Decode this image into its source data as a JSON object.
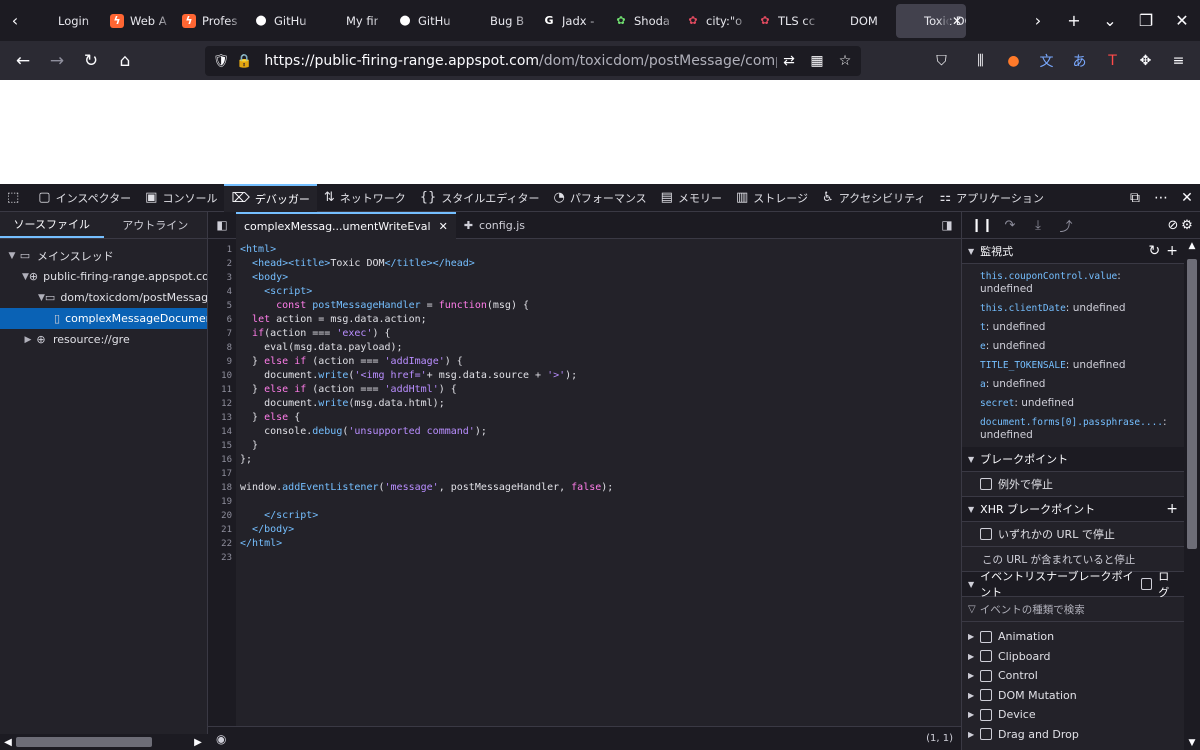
{
  "tabs": [
    {
      "label": "Login",
      "favicon": "",
      "color": ""
    },
    {
      "label": "Web A",
      "favicon": "burp-icon",
      "color": "#ff6633"
    },
    {
      "label": "Profes",
      "favicon": "burp-icon",
      "color": "#ff6633"
    },
    {
      "label": "GitHu",
      "favicon": "github-icon",
      "color": "#ffffff"
    },
    {
      "label": "My fir",
      "favicon": "",
      "color": ""
    },
    {
      "label": "GitHu",
      "favicon": "github-icon",
      "color": "#ffffff"
    },
    {
      "label": "Bug B",
      "favicon": "",
      "color": ""
    },
    {
      "label": "Jadx -",
      "favicon": "google-icon",
      "color": "#ffffff"
    },
    {
      "label": "Shoda",
      "favicon": "shodan-icon",
      "color": "#6fdd6f"
    },
    {
      "label": "city:\"o",
      "favicon": "shodan-red-icon",
      "color": "#e04a5f"
    },
    {
      "label": "TLS cc",
      "favicon": "shodan-red-icon",
      "color": "#e04a5f"
    },
    {
      "label": "DOM",
      "favicon": "",
      "color": ""
    },
    {
      "label": "Toxic DO",
      "favicon": "",
      "color": "",
      "active": true
    }
  ],
  "urlbar": {
    "host": "https://public-firing-range.appspot.com",
    "path": "/dom/toxicdom/postMessage/complexMessageDo"
  },
  "devtools": {
    "tabs": [
      {
        "label": "インスペクター",
        "icon": "inspector-icon"
      },
      {
        "label": "コンソール",
        "icon": "console-icon"
      },
      {
        "label": "デバッガー",
        "icon": "debugger-icon",
        "active": true
      },
      {
        "label": "ネットワーク",
        "icon": "network-icon"
      },
      {
        "label": "スタイルエディター",
        "icon": "style-editor-icon"
      },
      {
        "label": "パフォーマンス",
        "icon": "performance-icon"
      },
      {
        "label": "メモリー",
        "icon": "memory-icon"
      },
      {
        "label": "ストレージ",
        "icon": "storage-icon"
      },
      {
        "label": "アクセシビリティ",
        "icon": "accessibility-icon"
      },
      {
        "label": "アプリケーション",
        "icon": "application-icon"
      }
    ]
  },
  "sources": {
    "tab_sources": "ソースファイル",
    "tab_outline": "アウトライン",
    "tree": [
      {
        "label": "メインスレッド",
        "depth": 0,
        "arrow": "▼",
        "icon": "thread-icon"
      },
      {
        "label": "public-firing-range.appspot.com",
        "depth": 1,
        "arrow": "▼",
        "icon": "globe-icon"
      },
      {
        "label": "dom/toxicdom/postMessage",
        "depth": 2,
        "arrow": "▼",
        "icon": "folder-icon"
      },
      {
        "label": "complexMessageDocumentWriteEval",
        "depth": 3,
        "arrow": "",
        "icon": "file-icon",
        "selected": true
      },
      {
        "label": "resource://gre",
        "depth": 1,
        "arrow": "▶",
        "icon": "globe-icon"
      }
    ]
  },
  "editor": {
    "tab_active": "complexMessag...umentWriteEval",
    "tab_other": "config.js",
    "cursor_pos": "(1, 1)",
    "line_count": 23
  },
  "rightpane": {
    "watch_title": "監視式",
    "watch": [
      {
        "expr": "this.couponControl.value",
        "val": "undefined",
        "wrap": true
      },
      {
        "expr": "this.clientDate",
        "val": "undefined"
      },
      {
        "expr": "t",
        "val": "undefined"
      },
      {
        "expr": "e",
        "val": "undefined"
      },
      {
        "expr": "TITLE_TOKENSALE",
        "val": "undefined"
      },
      {
        "expr": "a",
        "val": "undefined"
      },
      {
        "expr": "secret",
        "val": "undefined"
      },
      {
        "expr": "document.forms[0].passphrase....",
        "val": "undefined",
        "wrap": true
      }
    ],
    "breakpoints_title": "ブレークポイント",
    "pause_exceptions": "例外で停止",
    "xhr_title": "XHR ブレークポイント",
    "xhr_any": "いずれかの URL で停止",
    "xhr_contains": "この URL が含まれていると停止",
    "event_title": "イベントリスナーブレークポイント",
    "event_log": "ログ",
    "event_filter": "イベントの種類で検索",
    "events": [
      "Animation",
      "Clipboard",
      "Control",
      "DOM Mutation",
      "Device",
      "Drag and Drop"
    ]
  }
}
